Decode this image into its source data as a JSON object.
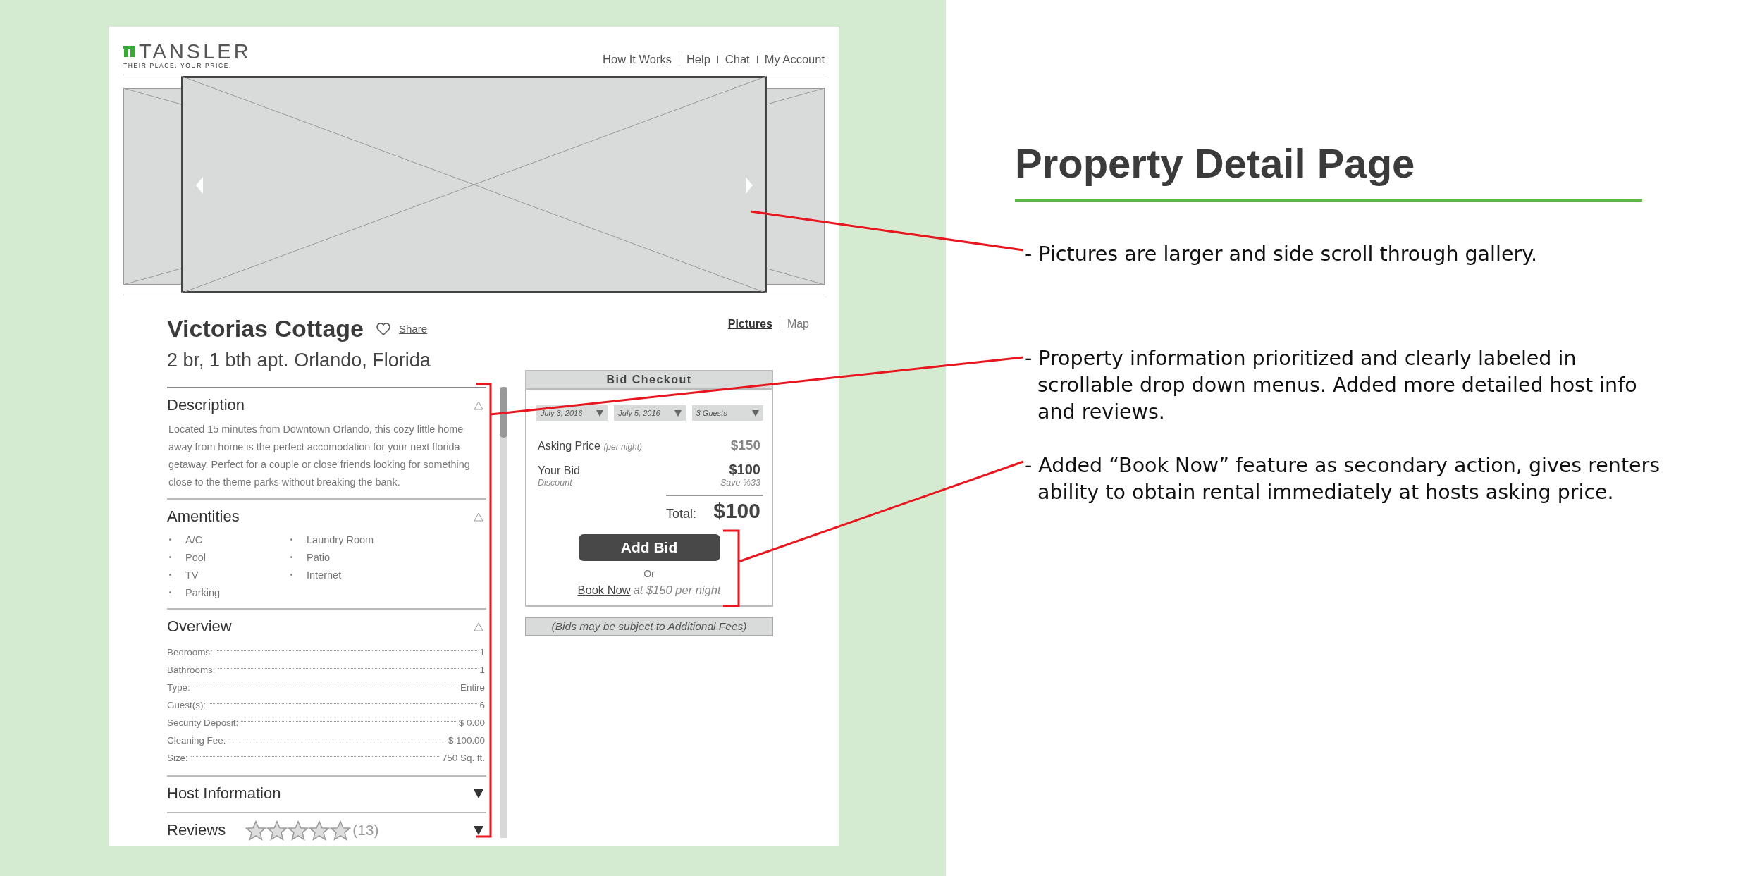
{
  "slide": {
    "title": "Property Detail Page",
    "notes": [
      "- Pictures are larger and side scroll through gallery.",
      "- Property information prioritized and clearly labeled in scrollable drop down menus. Added more detailed host info and reviews.",
      "- Added “Book Now” feature as secondary action, gives renters ability to obtain rental immediately at hosts asking price."
    ]
  },
  "site": {
    "logo": "TANSLER",
    "tagline": "THEIR PLACE. YOUR PRICE.",
    "nav": [
      "How It Works",
      "Help",
      "Chat",
      "My Account"
    ]
  },
  "property": {
    "name": "Victorias Cottage",
    "share": "Share",
    "subtitle": "2 br, 1 bth apt. Orlando, Florida",
    "views": [
      {
        "label": "Pictures",
        "selected": true
      },
      {
        "label": "Map",
        "selected": false
      }
    ]
  },
  "sections": [
    {
      "title": "Description",
      "expanded": true,
      "kind": "text",
      "text": "Located 15 minutes from Downtown Orlando, this cozy little home away from home is the perfect accomodation for your next florida getaway. Perfect for a couple or close friends looking for something close to the theme parks without breaking the bank."
    },
    {
      "title": "Amentities",
      "expanded": true,
      "kind": "list",
      "items": [
        "A/C",
        "Pool",
        "TV",
        "Parking",
        "Laundry Room",
        "Patio",
        "Internet"
      ]
    },
    {
      "title": "Overview",
      "expanded": true,
      "kind": "specs",
      "rows": [
        {
          "label": "Bedrooms:",
          "value": "1"
        },
        {
          "label": "Bathrooms:",
          "value": "1"
        },
        {
          "label": "Type:",
          "value": "Entire"
        },
        {
          "label": "Guest(s):",
          "value": "6"
        },
        {
          "label": "Security Deposit:",
          "value": "$ 0.00"
        },
        {
          "label": "Cleaning Fee:",
          "value": "$ 100.00"
        },
        {
          "label": "Size:",
          "value": "750 Sq. ft."
        }
      ]
    },
    {
      "title": "Host Information",
      "expanded": false,
      "kind": "plain"
    },
    {
      "title": "Reviews",
      "expanded": false,
      "kind": "rating",
      "stars": 0,
      "count": "(13)"
    }
  ],
  "checkout": {
    "title": "Bid Checkout",
    "selects": [
      "July 3, 2016",
      "July 5, 2016",
      "3 Guests"
    ],
    "asking_label": "Asking Price",
    "asking_note": "(per night)",
    "asking_value": "$150",
    "bid_label": "Your Bid",
    "bid_value": "$100",
    "discount_label": "Discount",
    "discount_value": "Save %33",
    "total_label": "Total:",
    "total_value": "$100",
    "button": "Add Bid",
    "or": "Or",
    "book_link": "Book Now",
    "book_note": "at $150 per night",
    "footer": "(Bids may be subject to Additional Fees)"
  }
}
